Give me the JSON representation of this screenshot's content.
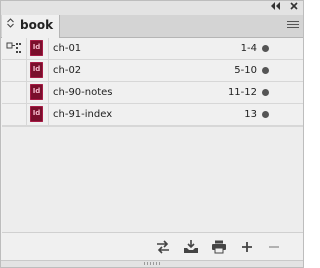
{
  "titlebar": {
    "collapse_icon": "double-chevron-left-icon",
    "close_icon": "close-icon"
  },
  "tab": {
    "label": "book",
    "chevron_icon": "up-down-chevron-icon"
  },
  "panel_menu_icon": "hamburger-menu-icon",
  "documents": [
    {
      "name": "ch-01",
      "pages": "1-4",
      "style_source": true,
      "status": "ok"
    },
    {
      "name": "ch-02",
      "pages": "5-10",
      "style_source": false,
      "status": "ok"
    },
    {
      "name": "ch-90-notes",
      "pages": "11-12",
      "style_source": false,
      "status": "ok"
    },
    {
      "name": "ch-91-index",
      "pages": "13",
      "style_source": false,
      "status": "ok"
    }
  ],
  "doc_icon_text": "Id",
  "footer_buttons": [
    {
      "name": "synchronize-icon"
    },
    {
      "name": "save-book-icon"
    },
    {
      "name": "print-book-icon"
    },
    {
      "name": "add-document-icon"
    },
    {
      "name": "remove-document-icon"
    }
  ],
  "colors": {
    "panel_bg": "#f0f0f0",
    "doc_icon": "#7a0f2c",
    "status_dot": "#555555"
  }
}
